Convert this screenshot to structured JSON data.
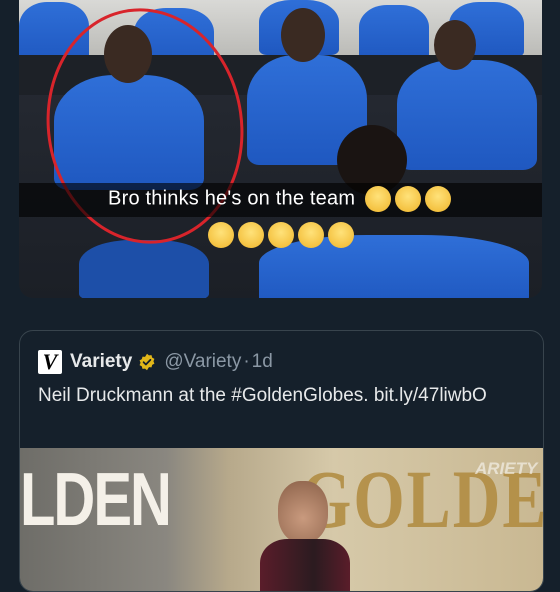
{
  "media": {
    "caption": "Bro thinks he's on the team",
    "inline_emoji_count": 3,
    "row_emoji_count": 5,
    "emoji_name": "relieved-face-emoji",
    "highlight_color": "#d8242b",
    "jersey_color": "#2f6fd8"
  },
  "quote": {
    "account_name": "Variety",
    "logo_letter": "V",
    "verified_badge": "gold-check-badge",
    "handle": "@Variety",
    "separator": "·",
    "time": "1d",
    "text": "Neil Druckmann at the #GoldenGlobes. bit.ly/47liwbO",
    "image": {
      "backdrop_text_left": "LDEN",
      "backdrop_text_right": "GOLDEN",
      "watermark": "ARIETY"
    },
    "colors": {
      "border": "#38444d",
      "muted": "#8b98a5",
      "badge": "#e2b719"
    }
  }
}
